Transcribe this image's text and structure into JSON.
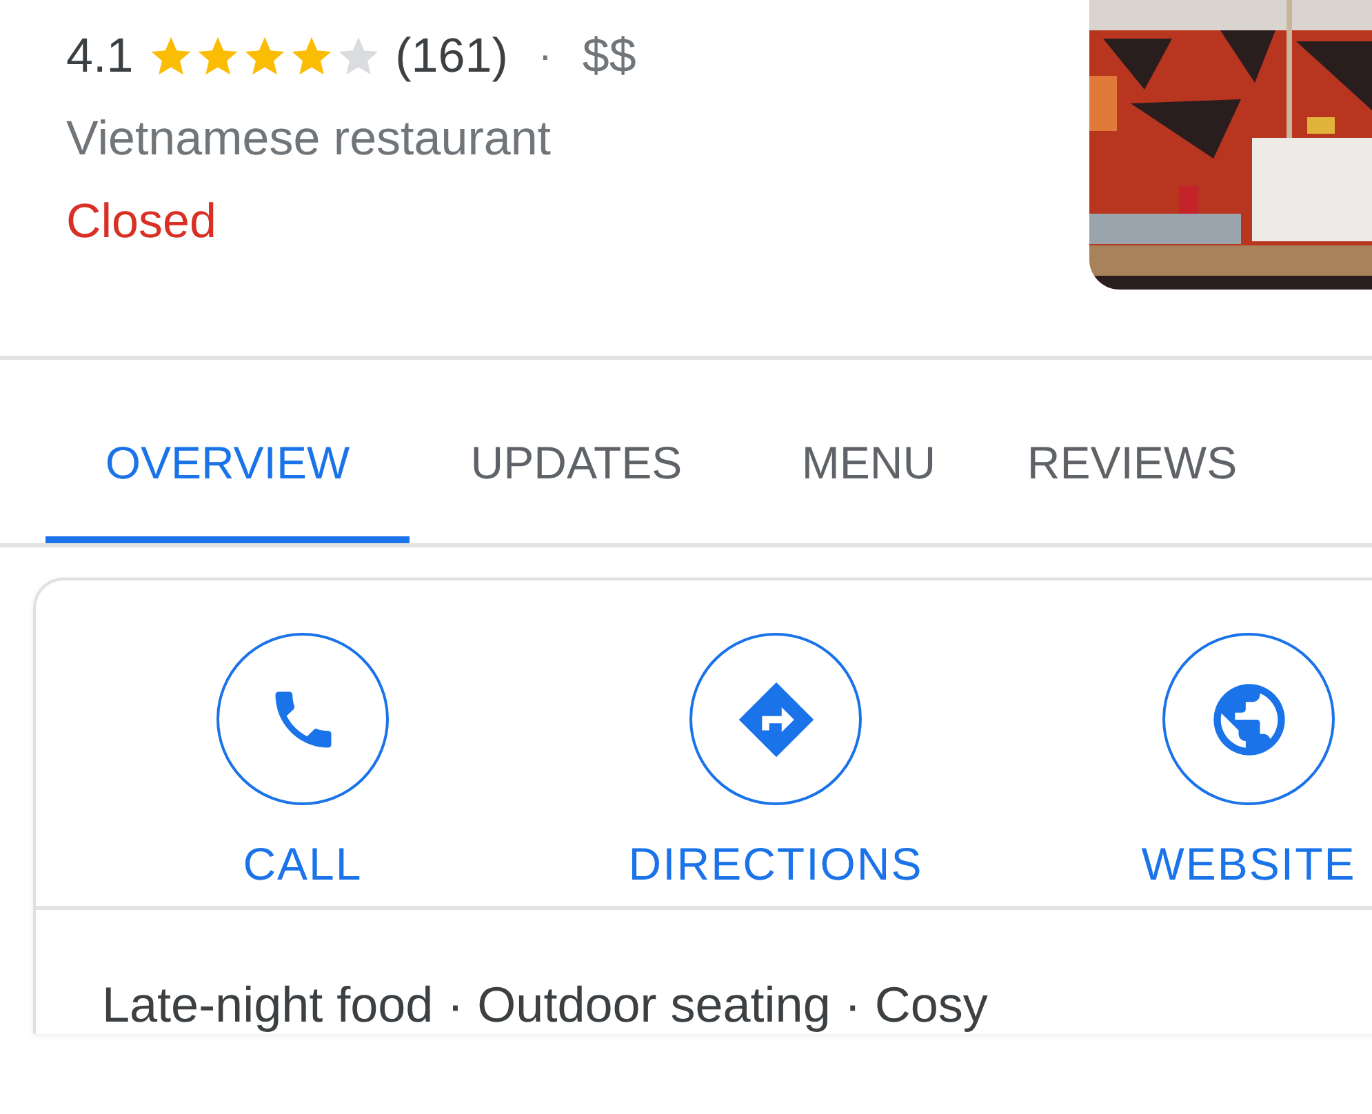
{
  "place": {
    "rating": "4.1",
    "stars": 4,
    "review_count": "(161)",
    "separator": "·",
    "price": "$$",
    "category": "Vietnamese restaurant",
    "status": "Closed"
  },
  "tabs": [
    {
      "label": "OVERVIEW",
      "selected": true
    },
    {
      "label": "UPDATES",
      "selected": false
    },
    {
      "label": "MENU",
      "selected": false
    },
    {
      "label": "REVIEWS",
      "selected": false
    }
  ],
  "actions": [
    {
      "kind": "call",
      "label": "CALL"
    },
    {
      "kind": "directions",
      "label": "DIRECTIONS"
    },
    {
      "kind": "website",
      "label": "WEBSITE"
    }
  ],
  "highlights": "Late-night food · Outdoor seating · Cosy"
}
